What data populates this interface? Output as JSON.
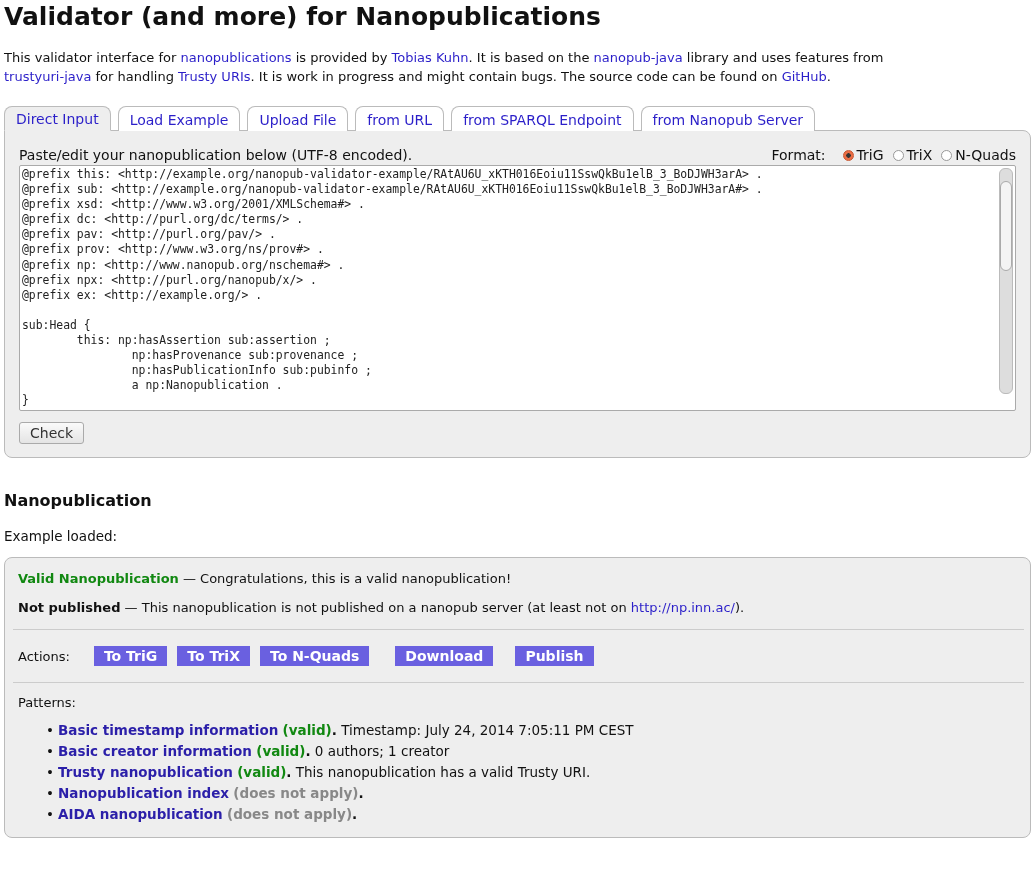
{
  "title": "Validator (and more) for Nanopublications",
  "intro": [
    {
      "kind": "text",
      "text": "This validator interface for "
    },
    {
      "kind": "link",
      "text": "nanopublications"
    },
    {
      "kind": "text",
      "text": " is provided by "
    },
    {
      "kind": "link",
      "text": "Tobias Kuhn"
    },
    {
      "kind": "text",
      "text": ". It is based on the "
    },
    {
      "kind": "link",
      "text": "nanopub-java"
    },
    {
      "kind": "text",
      "text": " library and uses features from "
    },
    {
      "kind": "link",
      "text": "trustyuri-java"
    },
    {
      "kind": "text",
      "text": " for handling "
    },
    {
      "kind": "link",
      "text": "Trusty URIs"
    },
    {
      "kind": "text",
      "text": ". It is work in progress and might contain bugs. The source code can be found on "
    },
    {
      "kind": "link",
      "text": "GitHub"
    },
    {
      "kind": "text",
      "text": "."
    }
  ],
  "tabs": [
    {
      "label": "Direct Input",
      "selected": true
    },
    {
      "label": "Load Example",
      "selected": false
    },
    {
      "label": "Upload File",
      "selected": false
    },
    {
      "label": "from URL",
      "selected": false
    },
    {
      "label": "from SPARQL Endpoint",
      "selected": false
    },
    {
      "label": "from Nanopub Server",
      "selected": false
    }
  ],
  "input_label": "Paste/edit your nanopublication below (UTF-8 encoded).",
  "format": {
    "label": "Format:",
    "options": [
      {
        "label": "TriG",
        "selected": true
      },
      {
        "label": "TriX",
        "selected": false
      },
      {
        "label": "N-Quads",
        "selected": false
      }
    ]
  },
  "editor_text": "@prefix this: <http://example.org/nanopub-validator-example/RAtAU6U_xKTH016Eoiu11SswQkBu1elB_3_BoDJWH3arA> .\n@prefix sub: <http://example.org/nanopub-validator-example/RAtAU6U_xKTH016Eoiu11SswQkBu1elB_3_BoDJWH3arA#> .\n@prefix xsd: <http://www.w3.org/2001/XMLSchema#> .\n@prefix dc: <http://purl.org/dc/terms/> .\n@prefix pav: <http://purl.org/pav/> .\n@prefix prov: <http://www.w3.org/ns/prov#> .\n@prefix np: <http://www.nanopub.org/nschema#> .\n@prefix npx: <http://purl.org/nanopub/x/> .\n@prefix ex: <http://example.org/> .\n\nsub:Head {\n        this: np:hasAssertion sub:assertion ;\n                np:hasProvenance sub:provenance ;\n                np:hasPublicationInfo sub:pubinfo ;\n                a np:Nanopublication .\n}",
  "check_button": "Check",
  "result_heading": "Nanopublication",
  "result_note": "Example loaded:",
  "validity": {
    "label": "Valid Nanopublication",
    "text": " — Congratulations, this is a valid nanopublication!"
  },
  "publication": {
    "label": "Not published",
    "text": " — This nanopublication is not published on a nanopub server (at least not on ",
    "link": "http://np.inn.ac/",
    "end": ")."
  },
  "actions": {
    "label": "Actions:",
    "buttons": [
      "To TriG",
      "To TriX",
      "To N-Quads",
      "Download",
      "Publish"
    ]
  },
  "patterns": {
    "label": "Patterns:",
    "items": [
      {
        "bullet": "•",
        "name": "Basic timestamp information",
        "status": "(valid)",
        "kind": "valid",
        "end": ".",
        "detail": "Timestamp: July 24, 2014 7:05:11 PM CEST"
      },
      {
        "bullet": "•",
        "name": "Basic creator information",
        "status": "(valid)",
        "kind": "valid",
        "end": ".",
        "detail": "0 authors; 1 creator"
      },
      {
        "bullet": "•",
        "name": "Trusty nanopublication",
        "status": "(valid)",
        "kind": "valid",
        "end": ".",
        "detail": "This nanopublication has a valid Trusty URI."
      },
      {
        "bullet": "•",
        "name": "Nanopublication index",
        "status": "(does not apply)",
        "kind": "not_applicable",
        "end": "."
      },
      {
        "bullet": "•",
        "name": "AIDA nanopublication",
        "status": "(does not apply)",
        "kind": "not_applicable",
        "end": "."
      }
    ]
  }
}
